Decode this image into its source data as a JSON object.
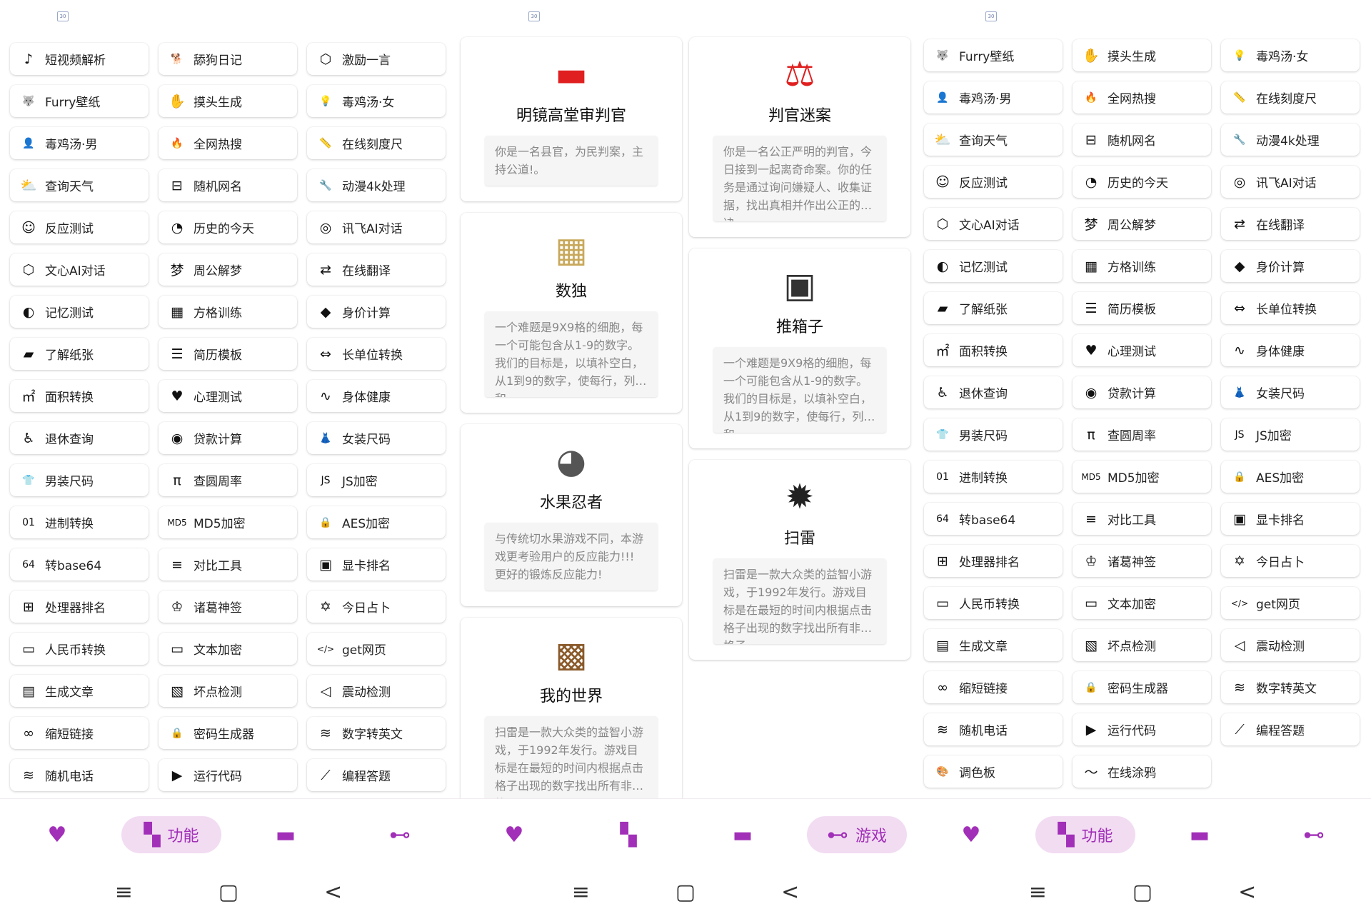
{
  "colors": {
    "accent": "#a12fb8",
    "active_bg": "#f2dcf2"
  },
  "status_icon": "30",
  "screen1": {
    "items": [
      {
        "label": "短视频解析",
        "icon": "tiktok-icon",
        "glyph": "♪"
      },
      {
        "label": "舔狗日记",
        "icon": "dog-icon",
        "glyph": "🐕"
      },
      {
        "label": "激励一言",
        "icon": "cube-icon",
        "glyph": "⬡"
      },
      {
        "label": "Furry壁纸",
        "icon": "wolf-icon",
        "glyph": "🐺"
      },
      {
        "label": "摸头生成",
        "icon": "hand-icon",
        "glyph": "✋"
      },
      {
        "label": "毒鸡汤·女",
        "icon": "lightbulb-icon",
        "glyph": "💡"
      },
      {
        "label": "毒鸡汤·男",
        "icon": "person-icon",
        "glyph": "👤"
      },
      {
        "label": "全网热搜",
        "icon": "fire-icon",
        "glyph": "🔥"
      },
      {
        "label": "在线刻度尺",
        "icon": "ruler-icon",
        "glyph": "📏"
      },
      {
        "label": "查询天气",
        "icon": "weather-icon",
        "glyph": "⛅"
      },
      {
        "label": "随机网名",
        "icon": "name-icon",
        "glyph": "⊟"
      },
      {
        "label": "动漫4k处理",
        "icon": "wrench-icon",
        "glyph": "🔧"
      },
      {
        "label": "反应测试",
        "icon": "smile-icon",
        "glyph": "☺"
      },
      {
        "label": "历史的今天",
        "icon": "clock-icon",
        "glyph": "◔"
      },
      {
        "label": "讯飞AI对话",
        "icon": "xunfei-icon",
        "glyph": "◎"
      },
      {
        "label": "文心AI对话",
        "icon": "wenxin-icon",
        "glyph": "⬡"
      },
      {
        "label": "周公解梦",
        "icon": "dream-icon",
        "glyph": "梦"
      },
      {
        "label": "在线翻译",
        "icon": "translate-icon",
        "glyph": "⇄"
      },
      {
        "label": "记忆测试",
        "icon": "brain-icon",
        "glyph": "◐"
      },
      {
        "label": "方格训练",
        "icon": "grid-numbers-icon",
        "glyph": "▦"
      },
      {
        "label": "身价计算",
        "icon": "diamond-icon",
        "glyph": "◆"
      },
      {
        "label": "了解纸张",
        "icon": "paper-icon",
        "glyph": "▰"
      },
      {
        "label": "简历模板",
        "icon": "resume-icon",
        "glyph": "☰"
      },
      {
        "label": "长单位转换",
        "icon": "unit-icon",
        "glyph": "⇔"
      },
      {
        "label": "面积转换",
        "icon": "area-icon",
        "glyph": "㎡"
      },
      {
        "label": "心理测试",
        "icon": "heart-icon",
        "glyph": "♥"
      },
      {
        "label": "身体健康",
        "icon": "pulse-icon",
        "glyph": "∿"
      },
      {
        "label": "退休查询",
        "icon": "retire-icon",
        "glyph": "♿"
      },
      {
        "label": "贷款计算",
        "icon": "loan-icon",
        "glyph": "◉"
      },
      {
        "label": "女装尺码",
        "icon": "dress-icon",
        "glyph": "👗"
      },
      {
        "label": "男装尺码",
        "icon": "shirt-icon",
        "glyph": "👕"
      },
      {
        "label": "查圆周率",
        "icon": "pi-icon",
        "glyph": "π"
      },
      {
        "label": "JS加密",
        "icon": "js-icon",
        "glyph": "JS"
      },
      {
        "label": "进制转换",
        "icon": "binary-icon",
        "glyph": "01"
      },
      {
        "label": "MD5加密",
        "icon": "md5-icon",
        "glyph": "MD5"
      },
      {
        "label": "AES加密",
        "icon": "lock-icon",
        "glyph": "🔒"
      },
      {
        "label": "转base64",
        "icon": "base64-icon",
        "glyph": "64"
      },
      {
        "label": "对比工具",
        "icon": "compare-icon",
        "glyph": "≡"
      },
      {
        "label": "显卡排名",
        "icon": "gpu-icon",
        "glyph": "▣"
      },
      {
        "label": "处理器排名",
        "icon": "cpu-icon",
        "glyph": "⊞"
      },
      {
        "label": "诸葛神签",
        "icon": "fortune-icon",
        "glyph": "♔"
      },
      {
        "label": "今日占卜",
        "icon": "star-of-david-icon",
        "glyph": "✡"
      },
      {
        "label": "人民币转换",
        "icon": "money-icon",
        "glyph": "▭"
      },
      {
        "label": "文本加密",
        "icon": "text-encrypt-icon",
        "glyph": "▭"
      },
      {
        "label": "get网页",
        "icon": "code-icon",
        "glyph": "</>"
      },
      {
        "label": "生成文章",
        "icon": "article-icon",
        "glyph": "▤"
      },
      {
        "label": "坏点检测",
        "icon": "pixel-check-icon",
        "glyph": "▧"
      },
      {
        "label": "震动检测",
        "icon": "vibrate-icon",
        "glyph": "◁"
      },
      {
        "label": "缩短链接",
        "icon": "link-icon",
        "glyph": "∞"
      },
      {
        "label": "密码生成器",
        "icon": "password-icon",
        "glyph": "🔒"
      },
      {
        "label": "数字转英文",
        "icon": "number-english-icon",
        "glyph": "≋"
      },
      {
        "label": "随机电话",
        "icon": "phone-wind-icon",
        "glyph": "≋"
      },
      {
        "label": "运行代码",
        "icon": "terminal-icon",
        "glyph": "▶"
      },
      {
        "label": "编程答题",
        "icon": "chart-quiz-icon",
        "glyph": "⟋"
      }
    ]
  },
  "screen2": {
    "col1": [
      {
        "title": "明镜高堂审判官",
        "icon": "gavel-icon",
        "glyph": "▬",
        "desc": "你是一名县官，为民判案，主持公道!。"
      },
      {
        "title": "数独",
        "icon": "sudoku-icon",
        "glyph": "▦",
        "desc": "一个难题是9X9格的细胞，每一个可能包含从1-9的数字。我们的目标是，以填补空白，从1到9的数字，使每行，列和..."
      },
      {
        "title": "水果忍者",
        "icon": "fruit-ninja-icon",
        "glyph": "◕",
        "desc": "与传统切水果游戏不同，本游戏更考验用户的反应能力!!! 更好的锻炼反应能力!"
      },
      {
        "title": "我的世界",
        "icon": "minecraft-icon",
        "glyph": "▩",
        "desc": "扫雷是一款大众类的益智小游戏，于1992年发行。游戏目标是在最短的时间内根据点击格子出现的数字找出所有非雷格子，..."
      }
    ],
    "col2": [
      {
        "title": "判官迷案",
        "icon": "judge-gavel-icon",
        "glyph": "⚖",
        "desc": "你是一名公正严明的判官，今日接到一起离奇命案。你的任务是通过询问嫌疑人、收集证据，找出真相并作出公正的判决。"
      },
      {
        "title": "推箱子",
        "icon": "box-push-icon",
        "glyph": "▣",
        "desc": "一个难题是9X9格的细胞，每一个可能包含从1-9的数字。我们的目标是，以填补空白，从1到9的数字，使每行，列和..."
      },
      {
        "title": "扫雷",
        "icon": "mine-icon",
        "glyph": "✹",
        "desc": "扫雷是一款大众类的益智小游戏，于1992年发行。游戏目标是在最短的时间内根据点击格子出现的数字找出所有非雷格子，..."
      }
    ]
  },
  "screen3": {
    "items": [
      {
        "label": "Furry壁纸",
        "icon": "wolf-icon",
        "glyph": "🐺"
      },
      {
        "label": "摸头生成",
        "icon": "hand-icon",
        "glyph": "✋"
      },
      {
        "label": "毒鸡汤·女",
        "icon": "lightbulb-icon",
        "glyph": "💡"
      },
      {
        "label": "毒鸡汤·男",
        "icon": "person-icon",
        "glyph": "👤"
      },
      {
        "label": "全网热搜",
        "icon": "fire-icon",
        "glyph": "🔥"
      },
      {
        "label": "在线刻度尺",
        "icon": "ruler-icon",
        "glyph": "📏"
      },
      {
        "label": "查询天气",
        "icon": "weather-icon",
        "glyph": "⛅"
      },
      {
        "label": "随机网名",
        "icon": "name-icon",
        "glyph": "⊟"
      },
      {
        "label": "动漫4k处理",
        "icon": "wrench-icon",
        "glyph": "🔧"
      },
      {
        "label": "反应测试",
        "icon": "smile-icon",
        "glyph": "☺"
      },
      {
        "label": "历史的今天",
        "icon": "clock-icon",
        "glyph": "◔"
      },
      {
        "label": "讯飞AI对话",
        "icon": "xunfei-icon",
        "glyph": "◎"
      },
      {
        "label": "文心AI对话",
        "icon": "wenxin-icon",
        "glyph": "⬡"
      },
      {
        "label": "周公解梦",
        "icon": "dream-icon",
        "glyph": "梦"
      },
      {
        "label": "在线翻译",
        "icon": "translate-icon",
        "glyph": "⇄"
      },
      {
        "label": "记忆测试",
        "icon": "brain-icon",
        "glyph": "◐"
      },
      {
        "label": "方格训练",
        "icon": "grid-numbers-icon",
        "glyph": "▦"
      },
      {
        "label": "身价计算",
        "icon": "diamond-icon",
        "glyph": "◆"
      },
      {
        "label": "了解纸张",
        "icon": "paper-icon",
        "glyph": "▰"
      },
      {
        "label": "简历模板",
        "icon": "resume-icon",
        "glyph": "☰"
      },
      {
        "label": "长单位转换",
        "icon": "unit-icon",
        "glyph": "⇔"
      },
      {
        "label": "面积转换",
        "icon": "area-icon",
        "glyph": "㎡"
      },
      {
        "label": "心理测试",
        "icon": "heart-icon",
        "glyph": "♥"
      },
      {
        "label": "身体健康",
        "icon": "pulse-icon",
        "glyph": "∿"
      },
      {
        "label": "退休查询",
        "icon": "retire-icon",
        "glyph": "♿"
      },
      {
        "label": "贷款计算",
        "icon": "loan-icon",
        "glyph": "◉"
      },
      {
        "label": "女装尺码",
        "icon": "dress-icon",
        "glyph": "👗"
      },
      {
        "label": "男装尺码",
        "icon": "shirt-icon",
        "glyph": "👕"
      },
      {
        "label": "查圆周率",
        "icon": "pi-icon",
        "glyph": "π"
      },
      {
        "label": "JS加密",
        "icon": "js-icon",
        "glyph": "JS"
      },
      {
        "label": "进制转换",
        "icon": "binary-icon",
        "glyph": "01"
      },
      {
        "label": "MD5加密",
        "icon": "md5-icon",
        "glyph": "MD5"
      },
      {
        "label": "AES加密",
        "icon": "lock-icon",
        "glyph": "🔒"
      },
      {
        "label": "转base64",
        "icon": "base64-icon",
        "glyph": "64"
      },
      {
        "label": "对比工具",
        "icon": "compare-icon",
        "glyph": "≡"
      },
      {
        "label": "显卡排名",
        "icon": "gpu-icon",
        "glyph": "▣"
      },
      {
        "label": "处理器排名",
        "icon": "cpu-icon",
        "glyph": "⊞"
      },
      {
        "label": "诸葛神签",
        "icon": "fortune-icon",
        "glyph": "♔"
      },
      {
        "label": "今日占卜",
        "icon": "star-of-david-icon",
        "glyph": "✡"
      },
      {
        "label": "人民币转换",
        "icon": "money-icon",
        "glyph": "▭"
      },
      {
        "label": "文本加密",
        "icon": "text-encrypt-icon",
        "glyph": "▭"
      },
      {
        "label": "get网页",
        "icon": "code-icon",
        "glyph": "</>"
      },
      {
        "label": "生成文章",
        "icon": "article-icon",
        "glyph": "▤"
      },
      {
        "label": "坏点检测",
        "icon": "pixel-check-icon",
        "glyph": "▧"
      },
      {
        "label": "震动检测",
        "icon": "vibrate-icon",
        "glyph": "◁"
      },
      {
        "label": "缩短链接",
        "icon": "link-icon",
        "glyph": "∞"
      },
      {
        "label": "密码生成器",
        "icon": "password-icon",
        "glyph": "🔒"
      },
      {
        "label": "数字转英文",
        "icon": "number-english-icon",
        "glyph": "≋"
      },
      {
        "label": "随机电话",
        "icon": "phone-wind-icon",
        "glyph": "≋"
      },
      {
        "label": "运行代码",
        "icon": "terminal-icon",
        "glyph": "▶"
      },
      {
        "label": "编程答题",
        "icon": "chart-quiz-icon",
        "glyph": "⟋"
      },
      {
        "label": "调色板",
        "icon": "palette-icon",
        "glyph": "🎨"
      },
      {
        "label": "在线涂鸦",
        "icon": "doodle-icon",
        "glyph": "〜"
      }
    ]
  },
  "nav": {
    "functions_label": "功能",
    "games_label": "游戏",
    "icons": {
      "favorites": "♥",
      "functions": "▚",
      "inbox": "▬",
      "games": "⊷"
    }
  },
  "sysbar": {
    "menu": "≡",
    "home": "▢",
    "back": "<"
  }
}
